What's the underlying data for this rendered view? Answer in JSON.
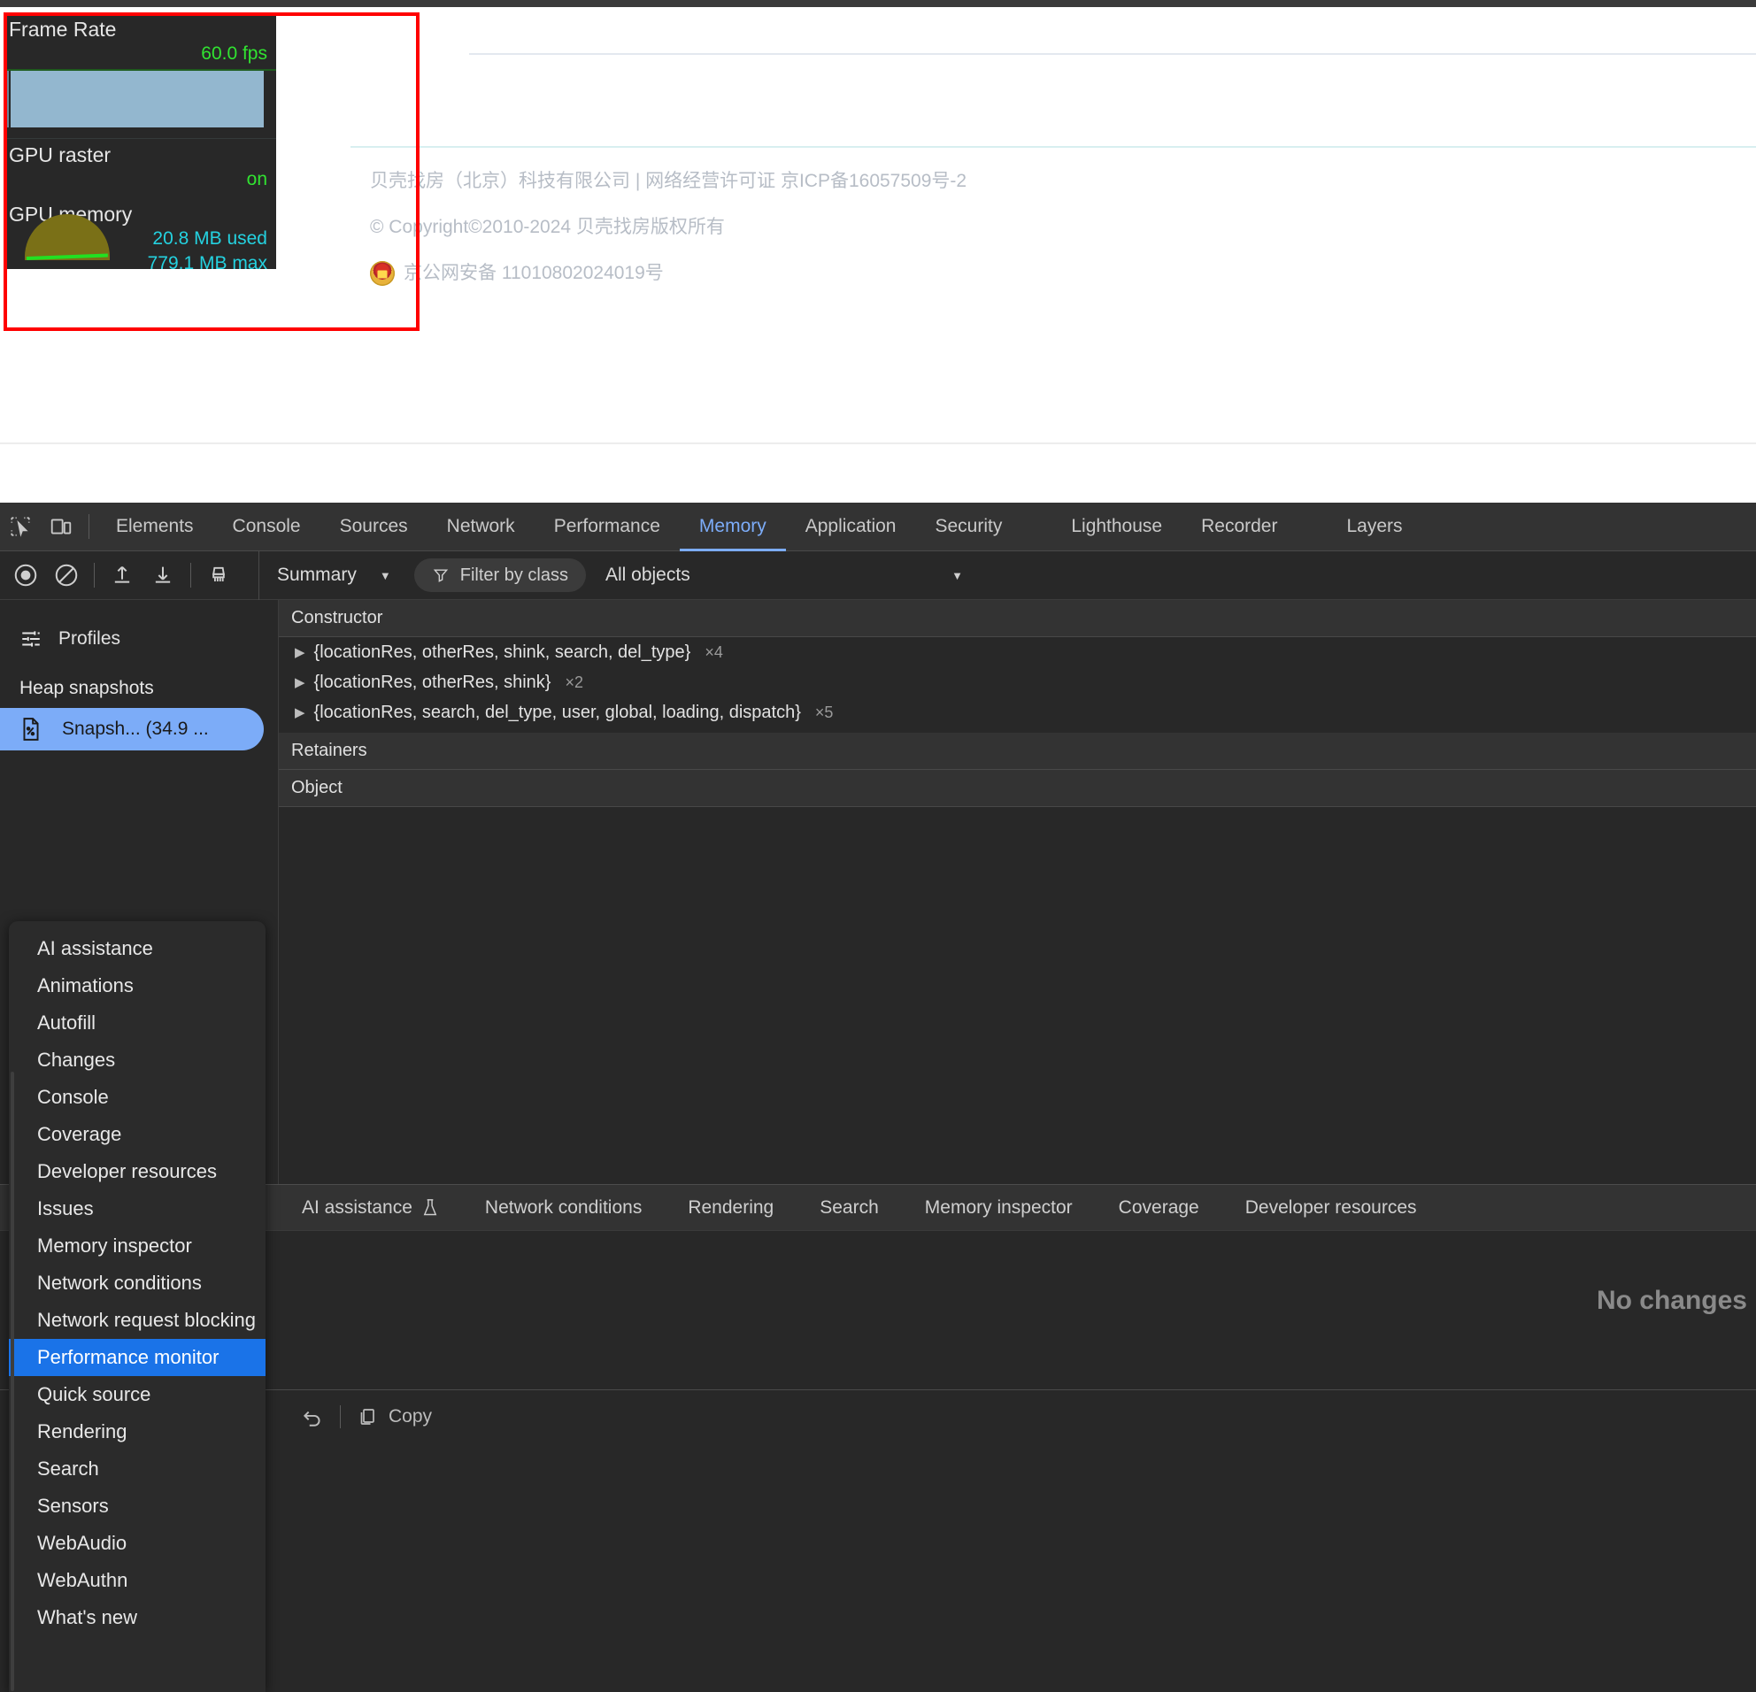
{
  "page": {
    "footer_lines": [
      "贝壳找房（北京）科技有限公司 | 网络经营许可证 京ICP备16057509号-2",
      "© Copyright©2010-2024 贝壳找房版权所有"
    ],
    "icp_police_text": "京公网安备 11010802024019号"
  },
  "fps_meter": {
    "groups": [
      {
        "title": "Frame Rate",
        "value": "60.0 fps",
        "color": "green"
      },
      {
        "title": "GPU raster",
        "value": "on",
        "color": "green"
      },
      {
        "title": "GPU memory",
        "value": "20.8 MB used",
        "value2": "779.1 MB max",
        "color": "cyan"
      }
    ],
    "colors": {
      "green": "#31e331",
      "cyan": "#24d2e0",
      "bar": "#93b7cf",
      "bg": "#282828"
    }
  },
  "devtools": {
    "inspect_icon": "inspect-element-icon",
    "device_icon": "device-toolbar-icon",
    "tabs": [
      {
        "label": "Elements",
        "active": false
      },
      {
        "label": "Console",
        "active": false
      },
      {
        "label": "Sources",
        "active": false
      },
      {
        "label": "Network",
        "active": false
      },
      {
        "label": "Performance",
        "active": false
      },
      {
        "label": "Memory",
        "active": true
      },
      {
        "label": "Application",
        "active": false
      },
      {
        "label": "Security",
        "active": false
      },
      {
        "label": "Lighthouse",
        "active": false
      },
      {
        "label": "Recorder",
        "active": false
      },
      {
        "label": "Layers",
        "active": false
      }
    ],
    "accent": "#7cacf8",
    "toolbar": {
      "record_icon": "record-heap-snapshot-icon",
      "clear_icon": "clear-icon",
      "load_icon": "load-profile-icon",
      "save_icon": "save-profile-icon",
      "delete_icon": "delete-profile-icon",
      "view_select": "Summary",
      "filter_label": "Filter by class",
      "filter_icon": "filter-icon",
      "objects_select": "All objects"
    },
    "sidebar": {
      "profiles_label": "Profiles",
      "profiles_icon": "profiles-icon",
      "section_label": "Heap snapshots",
      "snapshot_label": "Snapsh...   (34.9 ...",
      "snapshot_icon": "snapshot-file-icon"
    },
    "grid": {
      "constructor_header": "Constructor",
      "rows": [
        {
          "name": "{locationRes, otherRes, shink, search, del_type}",
          "count": "×4"
        },
        {
          "name": "{locationRes, otherRes, shink}",
          "count": "×2"
        },
        {
          "name": "{locationRes, search, del_type, user, global, loading, dispatch}",
          "count": "×5"
        }
      ],
      "retainers_header": "Retainers",
      "object_header": "Object"
    },
    "drawer": {
      "tabs": [
        {
          "label": "AI assistance",
          "icon": "experiment-flask-icon"
        },
        {
          "label": "Network conditions",
          "icon": ""
        },
        {
          "label": "Rendering",
          "icon": ""
        },
        {
          "label": "Search",
          "icon": ""
        },
        {
          "label": "Memory inspector",
          "icon": ""
        },
        {
          "label": "Coverage",
          "icon": ""
        },
        {
          "label": "Developer resources",
          "icon": ""
        }
      ],
      "empty_text": "No changes",
      "undo_icon": "undo-icon",
      "copy_icon": "copy-icon",
      "copy_label": "Copy"
    },
    "more_tools_menu": {
      "items": [
        {
          "label": "AI assistance",
          "selected": false
        },
        {
          "label": "Animations",
          "selected": false
        },
        {
          "label": "Autofill",
          "selected": false
        },
        {
          "label": "Changes",
          "selected": false
        },
        {
          "label": "Console",
          "selected": false
        },
        {
          "label": "Coverage",
          "selected": false
        },
        {
          "label": "Developer resources",
          "selected": false
        },
        {
          "label": "Issues",
          "selected": false
        },
        {
          "label": "Memory inspector",
          "selected": false
        },
        {
          "label": "Network conditions",
          "selected": false
        },
        {
          "label": "Network request blocking",
          "selected": false
        },
        {
          "label": "Performance monitor",
          "selected": true
        },
        {
          "label": "Quick source",
          "selected": false
        },
        {
          "label": "Rendering",
          "selected": false
        },
        {
          "label": "Search",
          "selected": false
        },
        {
          "label": "Sensors",
          "selected": false
        },
        {
          "label": "WebAudio",
          "selected": false
        },
        {
          "label": "WebAuthn",
          "selected": false
        },
        {
          "label": "What's new",
          "selected": false
        }
      ],
      "selected_color": "#1a73e8"
    }
  },
  "annotations": {
    "color": "#ff0000",
    "boxes": [
      "fps-meter-region",
      "performance-monitor-item",
      "rendering-item"
    ]
  }
}
